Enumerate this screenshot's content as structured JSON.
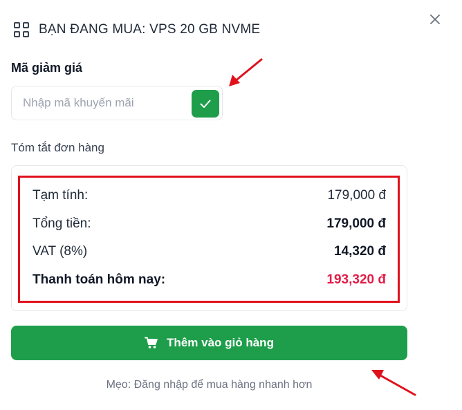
{
  "header": {
    "title": "BẠN ĐANG MUA: VPS 20 GB NVME",
    "icon": "grid-icon",
    "close_icon": "close-icon"
  },
  "promo": {
    "label": "Mã giảm giá",
    "placeholder": "Nhập mã khuyến mãi",
    "value": "",
    "apply_icon": "check-icon"
  },
  "summary": {
    "label": "Tóm tắt đơn hàng",
    "rows": [
      {
        "label": "Tạm tính:",
        "value": "179,000 đ"
      },
      {
        "label": "Tổng tiền:",
        "value": "179,000 đ"
      },
      {
        "label": "VAT (8%)",
        "value": "14,320 đ"
      },
      {
        "label": "Thanh toán hôm nay:",
        "value": "193,320 đ"
      }
    ]
  },
  "cart_button": {
    "label": "Thêm vào giỏ hàng",
    "icon": "cart-icon"
  },
  "tip": "Mẹo: Đăng nhập để mua hàng nhanh hơn",
  "colors": {
    "accent_green": "#1e9e4a",
    "total_pink": "#e11d48",
    "annotation_red": "#e0111c"
  }
}
